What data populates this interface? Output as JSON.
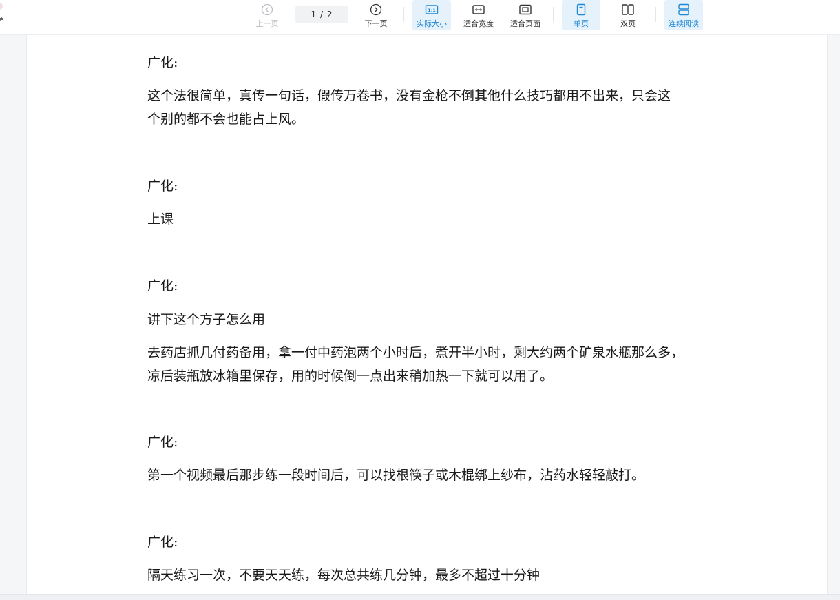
{
  "toolbar": {
    "prev_label": "上一页",
    "page_indicator": "1  / 2",
    "next_label": "下一页",
    "actual_size_label": "实际大小",
    "fit_width_label": "适合宽度",
    "fit_page_label": "适合页面",
    "single_page_label": "单页",
    "double_page_label": "双页",
    "continuous_label": "连续阅读",
    "accent_color": "#1e88d6"
  },
  "left_stub_char": "≢",
  "document": {
    "blocks": [
      {
        "speaker": "广化:",
        "lines": [
          "这个法很简单，真传一句话，假传万卷书，没有金枪不倒其他什么技巧都用不出来，只会这",
          "个别的都不会也能占上风。"
        ]
      },
      {
        "speaker": "广化:",
        "lines": [
          "上课"
        ]
      },
      {
        "speaker": "广化:",
        "lines": [
          "讲下这个方子怎么用",
          "去药店抓几付药备用，拿一付中药泡两个小时后，煮开半小时，剩大约两个矿泉水瓶那么多，",
          "凉后装瓶放冰箱里保存，用的时候倒一点出来稍加热一下就可以用了。"
        ]
      },
      {
        "speaker": "广化:",
        "lines": [
          "第一个视频最后那步练一段时间后，可以找根筷子或木棍绑上纱布，沾药水轻轻敲打。"
        ]
      },
      {
        "speaker": "广化:",
        "lines": [
          "隔天练习一次，不要天天练，每次总共练几分钟，最多不超过十分钟"
        ]
      }
    ]
  }
}
